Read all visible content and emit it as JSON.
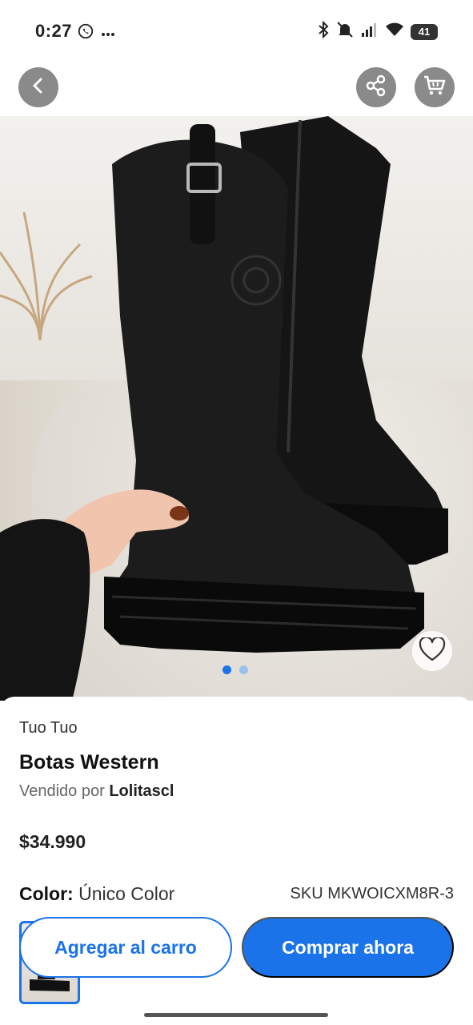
{
  "status_bar": {
    "time": "0:27",
    "battery": "41",
    "icons": [
      "whatsapp-icon",
      "more-dots-icon",
      "bluetooth-icon",
      "mute-icon",
      "signal-icon",
      "wifi-icon",
      "battery-icon"
    ]
  },
  "top_bar": {
    "icons": [
      "back-arrow-icon",
      "share-icon",
      "cart-icon"
    ]
  },
  "gallery": {
    "image_count": 2,
    "active_index": 0,
    "favorite_icon": "heart-outline-icon"
  },
  "product": {
    "brand": "Tuo Tuo",
    "title": "Botas Western",
    "sold_by_prefix": "Vendido por",
    "seller": "Lolitascl",
    "price": "$34.990",
    "color_label": "Color:",
    "color_value": "Único Color",
    "sku": "SKU MKWOICXM8R-3"
  },
  "actions": {
    "add_to_cart": "Agregar al carro",
    "buy_now": "Comprar ahora"
  },
  "colors": {
    "accent": "#1a73e8",
    "top_button_bg": "#8a8a8a"
  }
}
